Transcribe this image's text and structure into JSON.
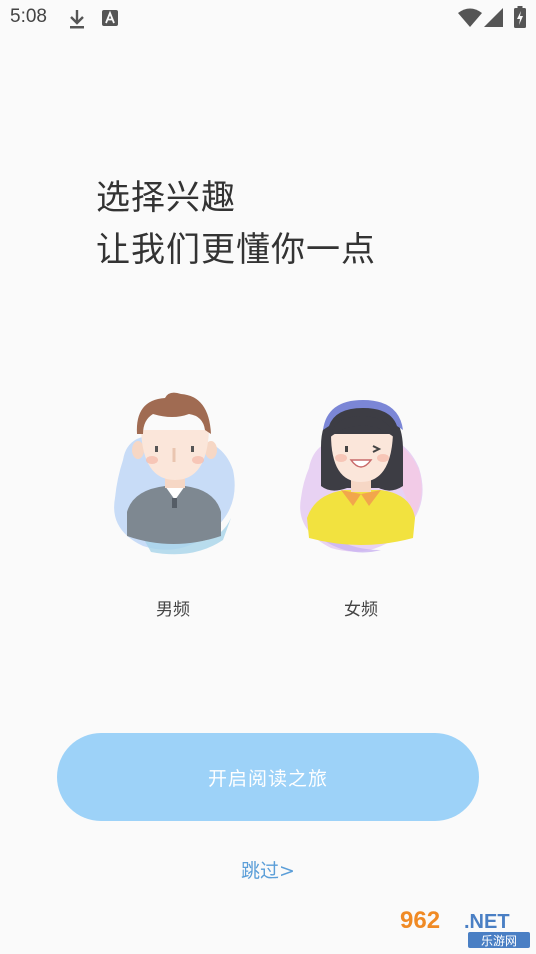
{
  "status_bar": {
    "time": "5:08",
    "icons": [
      "download-icon",
      "a-notification-icon",
      "wifi-icon",
      "signal-icon",
      "battery-charging-icon"
    ]
  },
  "headline": {
    "line1": "选择兴趣",
    "line2": "让我们更懂你一点"
  },
  "options": [
    {
      "label": "男频",
      "icon": "male-avatar-icon"
    },
    {
      "label": "女频",
      "icon": "female-avatar-icon"
    }
  ],
  "start_button": {
    "label": "开启阅读之旅"
  },
  "skip": {
    "label": "跳过>"
  },
  "watermark": {
    "line1": "962.NET",
    "line2": "乐游网"
  },
  "colors": {
    "button": "#9dd2f8",
    "skip_link": "#5b9ed8",
    "background": "#fafafa"
  }
}
